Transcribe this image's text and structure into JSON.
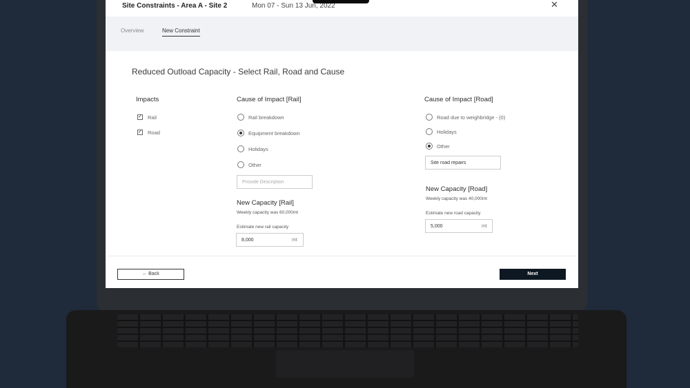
{
  "window": {
    "title": "Site Constraints - Area A - Site 2",
    "date_range": "Mon 07 - Sun 13 Jun, 2022",
    "close_glyph": "✕"
  },
  "tabs": [
    {
      "label": "Overview",
      "active": false
    },
    {
      "label": "New Constraint",
      "active": true
    }
  ],
  "page": {
    "title": "Reduced Outload Capacity - Select Rail, Road and Cause"
  },
  "impacts": {
    "heading": "Impacts",
    "items": [
      {
        "label": "Rail",
        "checked": true
      },
      {
        "label": "Road",
        "checked": true
      }
    ]
  },
  "rail": {
    "cause_heading": "Cause of Impact [Rail]",
    "options": [
      {
        "label": "Rail breakdown",
        "selected": false
      },
      {
        "label": "Equipment breakdown",
        "selected": true
      },
      {
        "label": "Holidays",
        "selected": false
      },
      {
        "label": "Other",
        "selected": false
      }
    ],
    "description_placeholder": "Provide Description",
    "capacity_heading": "New Capacity [Rail]",
    "weekly_note": "Weekly capacity was 60,000mt",
    "estimate_label": "Estimate new rail capacity",
    "estimate_value": "8,000",
    "unit": "mt"
  },
  "road": {
    "cause_heading": "Cause of Impact [Road]",
    "options": [
      {
        "label": "Road due to weighbridge - (0)",
        "selected": false
      },
      {
        "label": "Holidays",
        "selected": false
      },
      {
        "label": "Other",
        "selected": true
      }
    ],
    "description_value": "Site road repairs",
    "capacity_heading": "New Capacity [Road]",
    "weekly_note": "Weekly capacity was 40,000mt",
    "estimate_label": "Estimate new road capacity",
    "estimate_value": "5,000",
    "unit": "mt"
  },
  "footer": {
    "back_label": "← Back",
    "next_label": "Next"
  },
  "colors": {
    "background": "#1f2a3a",
    "next_button": "#0e1822",
    "tab_bar": "#f1f2f5"
  }
}
